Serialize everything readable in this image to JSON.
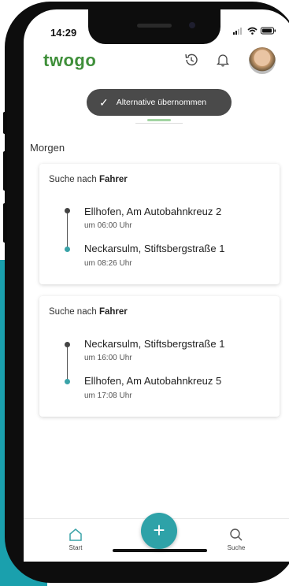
{
  "status_bar": {
    "time": "14:29"
  },
  "app": {
    "logo_text": "twogo"
  },
  "toast": {
    "message": "Alternative übernommen"
  },
  "section": {
    "title": "Morgen"
  },
  "trips": [
    {
      "search_prefix": "Suche nach ",
      "search_role": "Fahrer",
      "from_name": "Ellhofen, Am Autobahnkreuz 2",
      "from_time": "um 06:00 Uhr",
      "to_name": "Neckarsulm, Stiftsbergstraße 1",
      "to_time": "um 08:26 Uhr"
    },
    {
      "search_prefix": "Suche nach ",
      "search_role": "Fahrer",
      "from_name": "Neckarsulm, Stiftsbergstraße 1",
      "from_time": "um 16:00 Uhr",
      "to_name": "Ellhofen, Am Autobahnkreuz 5",
      "to_time": "um 17:08 Uhr"
    }
  ],
  "bottom_nav": {
    "start_label": "Start",
    "search_label": "Suche",
    "fab_symbol": "+"
  },
  "icons": [
    "history-icon",
    "bell-icon",
    "avatar",
    "check-icon",
    "home-icon",
    "search-icon",
    "add-icon"
  ],
  "colors": {
    "accent_teal": "#2ea2a8",
    "logo_green": "#3f8f3a",
    "dot_dark": "#444444",
    "dot_teal": "#3aa3a8"
  }
}
